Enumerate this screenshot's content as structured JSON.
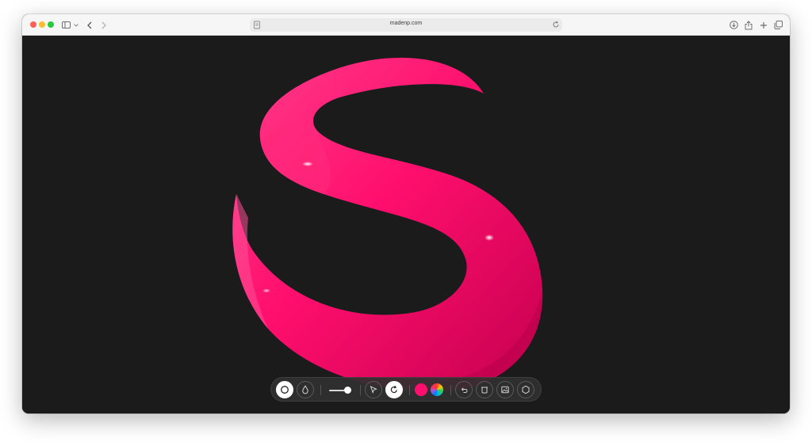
{
  "browser": {
    "url": "madenp.com",
    "icons": [
      "sidebar-icon",
      "chevron-down-icon",
      "back-icon",
      "forward-icon",
      "reload-icon",
      "download-icon",
      "share-icon",
      "new-tab-icon",
      "tabs-overview-icon"
    ]
  },
  "canvas": {
    "background_color": "#1b1b1b",
    "shape_color": "#ff0f6d"
  },
  "toolbar": {
    "tools": [
      "circle-brush-icon",
      "drop-icon",
      "size-slider",
      "select-arrow-icon",
      "rotate-icon",
      "color-swatch",
      "color-wheel-icon",
      "undo-icon",
      "delete-icon",
      "image-icon",
      "hexagon-icon"
    ],
    "active_tools": [
      "circle-brush-icon",
      "rotate-icon"
    ],
    "brush_size_fraction": 0.85,
    "current_color": "#ff0f6d"
  }
}
